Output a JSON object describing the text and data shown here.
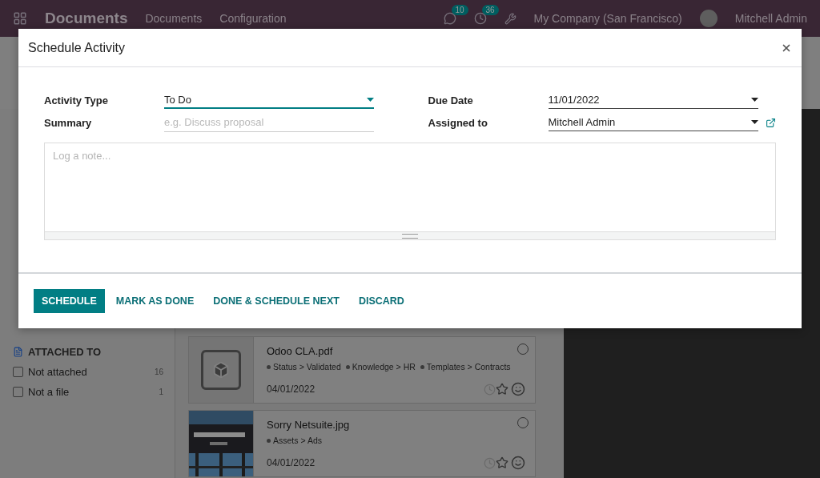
{
  "navbar": {
    "app": "Documents",
    "menus": [
      "Documents",
      "Configuration"
    ],
    "messages_badge": "10",
    "activities_badge": "36",
    "company": "My Company (San Francisco)",
    "user": "Mitchell Admin"
  },
  "sidebar": {
    "section": "ATTACHED TO",
    "filters": [
      {
        "label": "Not attached",
        "count": "16",
        "checked": false
      },
      {
        "label": "Not a file",
        "count": "1",
        "checked": false
      }
    ]
  },
  "documents": [
    {
      "name": "Odoo CLA.pdf",
      "tags": [
        "Status > Validated",
        "Knowledge > HR",
        "Templates > Contracts"
      ],
      "date": "04/01/2022",
      "kind": "file",
      "selected": false
    },
    {
      "name": "Sorry Netsuite.jpg",
      "tags": [
        "Assets > Ads"
      ],
      "date": "04/01/2022",
      "kind": "picture",
      "selected": false
    }
  ],
  "dialog": {
    "title": "Schedule Activity",
    "columns": [
      [
        {
          "label": "Activity Type",
          "value": "To Do",
          "kind": "select",
          "focused": true
        },
        {
          "label": "Summary",
          "placeholder": "e.g. Discuss proposal",
          "kind": "text"
        }
      ],
      [
        {
          "label": "Due Date",
          "value": "11/01/2022",
          "kind": "select",
          "focused": false
        },
        {
          "label": "Assigned to",
          "value": "Mitchell Admin",
          "kind": "select",
          "focused": false,
          "external_link": true
        }
      ]
    ],
    "note": {
      "placeholder": "Log a note..."
    },
    "buttons": [
      {
        "label": "SCHEDULE",
        "primary": true
      },
      {
        "label": "MARK AS DONE",
        "primary": false
      },
      {
        "label": "DONE & SCHEDULE NEXT",
        "primary": false
      },
      {
        "label": "DISCARD",
        "primary": false
      }
    ]
  }
}
